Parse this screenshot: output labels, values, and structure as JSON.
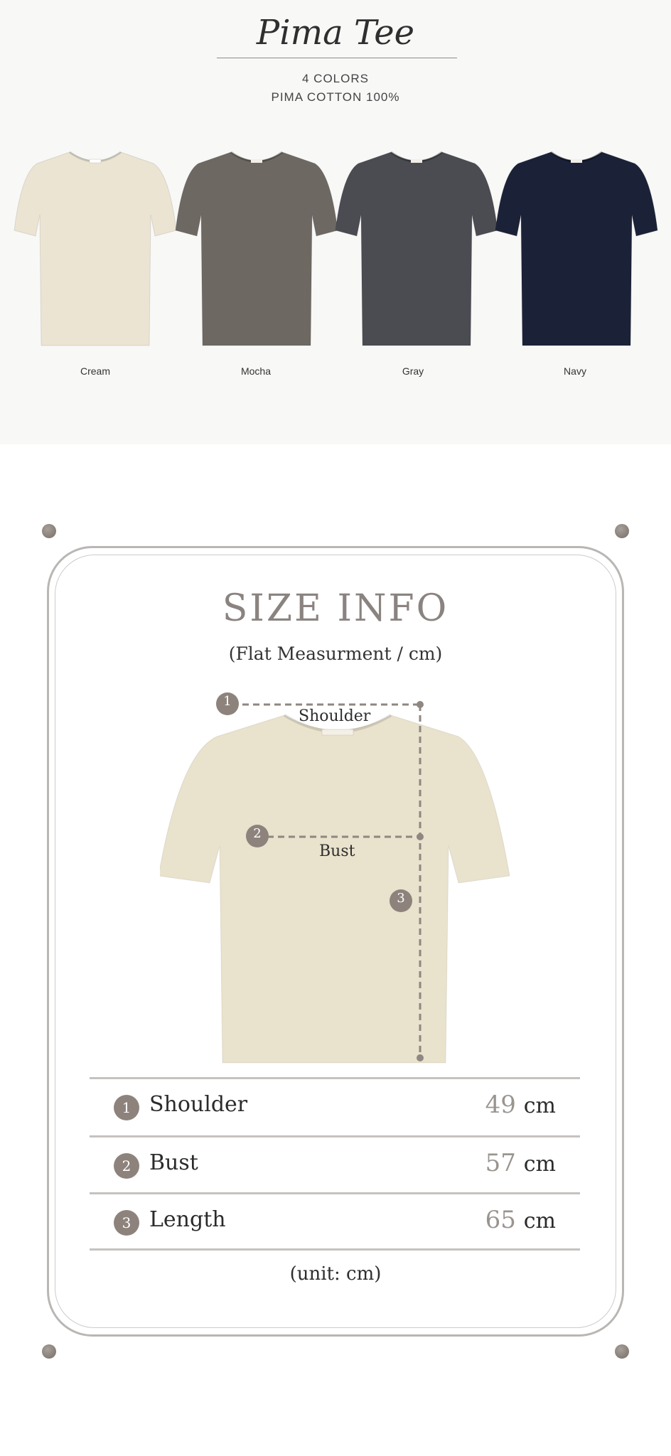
{
  "header": {
    "title": "Pima Tee",
    "colors_count": "4 COLORS",
    "material": "PIMA COTTON 100%"
  },
  "variants": [
    {
      "label": "Cream",
      "color": "#ebe4d2"
    },
    {
      "label": "Mocha",
      "color": "#6e6863"
    },
    {
      "label": "Gray",
      "color": "#4a4c52"
    },
    {
      "label": "Navy",
      "color": "#1b2238"
    }
  ],
  "size_info": {
    "title": "SIZE INFO",
    "subtitle": "(Flat Measurment / cm)",
    "diagram_labels": {
      "shoulder": "Shoulder",
      "bust": "Bust"
    },
    "markers": [
      "1",
      "2",
      "3"
    ],
    "rows": [
      {
        "num": "1",
        "name": "Shoulder",
        "value": "49",
        "unit": "cm"
      },
      {
        "num": "2",
        "name": "Bust",
        "value": "57",
        "unit": "cm"
      },
      {
        "num": "3",
        "name": "Length",
        "value": "65",
        "unit": "cm"
      }
    ],
    "unit_note": "(unit: cm)"
  },
  "colors": {
    "accent": "#8d837c",
    "frame": "#b9b6b3",
    "cream_tee": "#e9e2cc"
  }
}
